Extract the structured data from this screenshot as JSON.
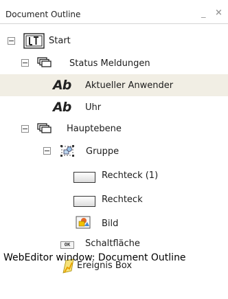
{
  "panel": {
    "title": "Document Outline",
    "minimize_label": "_",
    "close_label": "×"
  },
  "tree": {
    "start": {
      "label": "Start"
    },
    "status": {
      "label": "Status Meldungen"
    },
    "aktueller": {
      "icon_text": "Ab",
      "label": "Aktueller Anwender"
    },
    "uhr": {
      "icon_text": "Ab",
      "label": "Uhr"
    },
    "haupt": {
      "label": "Hauptebene"
    },
    "gruppe": {
      "label": "Gruppe"
    },
    "rechteck1": {
      "label": "Rechteck (1)"
    },
    "rechteck": {
      "label": "Rechteck"
    },
    "bild": {
      "label": "Bild"
    },
    "schalt": {
      "icon_text": "OK",
      "label": "Schaltfläche"
    },
    "ereignis": {
      "label": "Ereignis Box"
    }
  },
  "caption": "WebEditor window: Document Outline",
  "colors": {
    "selection": "#f1eee4",
    "text": "#1b1b1b",
    "toggle_border": "#8a8a8a"
  }
}
